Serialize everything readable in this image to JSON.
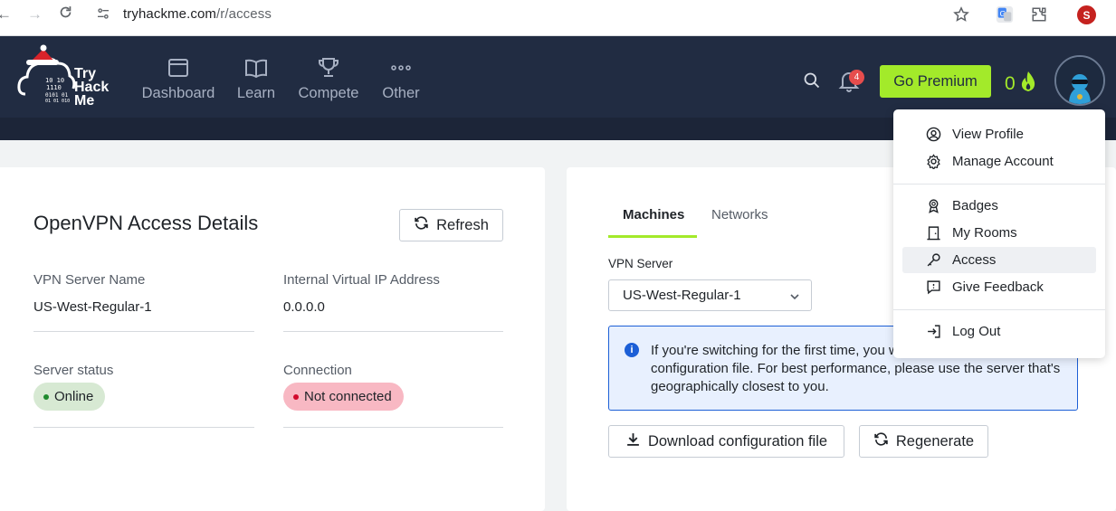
{
  "browser": {
    "url_host": "tryhackme.com",
    "url_path": "/r/access",
    "profile_initial": "S"
  },
  "header": {
    "logo_text": [
      "Try",
      "Hack",
      "Me"
    ],
    "nav": [
      {
        "label": "Dashboard",
        "icon": "window-icon"
      },
      {
        "label": "Learn",
        "icon": "book-icon"
      },
      {
        "label": "Compete",
        "icon": "trophy-icon"
      },
      {
        "label": "Other",
        "icon": "dots-icon"
      }
    ],
    "notification_count": "4",
    "premium_label": "Go Premium",
    "streak_count": "0"
  },
  "access": {
    "title": "OpenVPN Access Details",
    "refresh_label": "Refresh",
    "vpn_server_name_label": "VPN Server Name",
    "vpn_server_name_value": "US-West-Regular-1",
    "internal_ip_label": "Internal Virtual IP Address",
    "internal_ip_value": "0.0.0.0",
    "server_status_label": "Server status",
    "server_status_value": "Online",
    "connection_label": "Connection",
    "connection_value": "Not connected"
  },
  "vpn_panel": {
    "tabs": [
      "Machines",
      "Networks"
    ],
    "active_tab": "Machines",
    "server_label": "VPN Server",
    "server_selected": "US-West-Regular-1",
    "info_text": "If you're switching for the first time, you will need to download your configuration file. For best performance, please use the server that's geographically closest to you.",
    "download_label": "Download configuration file",
    "regenerate_label": "Regenerate"
  },
  "user_menu": {
    "items": [
      {
        "label": "View Profile",
        "icon": "user-circle-icon"
      },
      {
        "label": "Manage Account",
        "icon": "gear-icon"
      },
      {
        "label": "Badges",
        "icon": "badge-icon"
      },
      {
        "label": "My Rooms",
        "icon": "door-icon"
      },
      {
        "label": "Access",
        "icon": "key-icon"
      },
      {
        "label": "Give Feedback",
        "icon": "feedback-icon"
      },
      {
        "label": "Log Out",
        "icon": "logout-icon"
      }
    ],
    "active_item": "Access"
  },
  "colors": {
    "header_bg": "#212c42",
    "accent_green": "#a3ea2a",
    "online_bg": "#d7e9d3",
    "online_dot": "#1f8a2e",
    "not_connected_bg": "#f8b8c3",
    "not_connected_dot": "#d10a2c",
    "info_border": "#1c5fd6"
  }
}
